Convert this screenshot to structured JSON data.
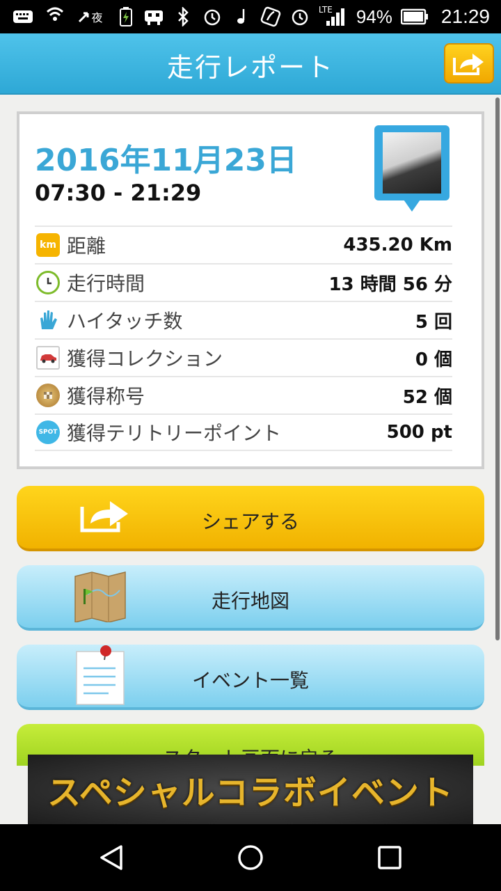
{
  "status_bar": {
    "battery": "94%",
    "time": "21:29",
    "yoru_label": "夜",
    "lte_label": "LTE"
  },
  "header": {
    "title": "走行レポート"
  },
  "report": {
    "date": "2016年11月23日",
    "time_range": "07:30 - 21:29",
    "rows": [
      {
        "icon": "km-icon",
        "icon_text": "km",
        "label": "距離",
        "value": "435.20 Km"
      },
      {
        "icon": "clock-icon",
        "label": "走行時間",
        "value": "13 時間 56 分"
      },
      {
        "icon": "high-touch-icon",
        "label": "ハイタッチ数",
        "value": "5 回"
      },
      {
        "icon": "car-icon",
        "label": "獲得コレクション",
        "value": "0 個"
      },
      {
        "icon": "medal-icon",
        "label": "獲得称号",
        "value": "52 個"
      },
      {
        "icon": "spot-icon",
        "icon_text": "SPOT",
        "label": "獲得テリトリーポイント",
        "value": "500 pt"
      }
    ]
  },
  "buttons": {
    "share": "シェアする",
    "map": "走行地図",
    "events": "イベント一覧",
    "start": "スタート画面に戻る"
  },
  "ad": {
    "text": "スペシャルコラボイベント"
  },
  "colors": {
    "header_blue": "#2ea8d6",
    "date_blue": "#3aa7d6",
    "share_yellow": "#f1b200",
    "button_blue": "#7ccfee",
    "start_green": "#9fd320"
  }
}
